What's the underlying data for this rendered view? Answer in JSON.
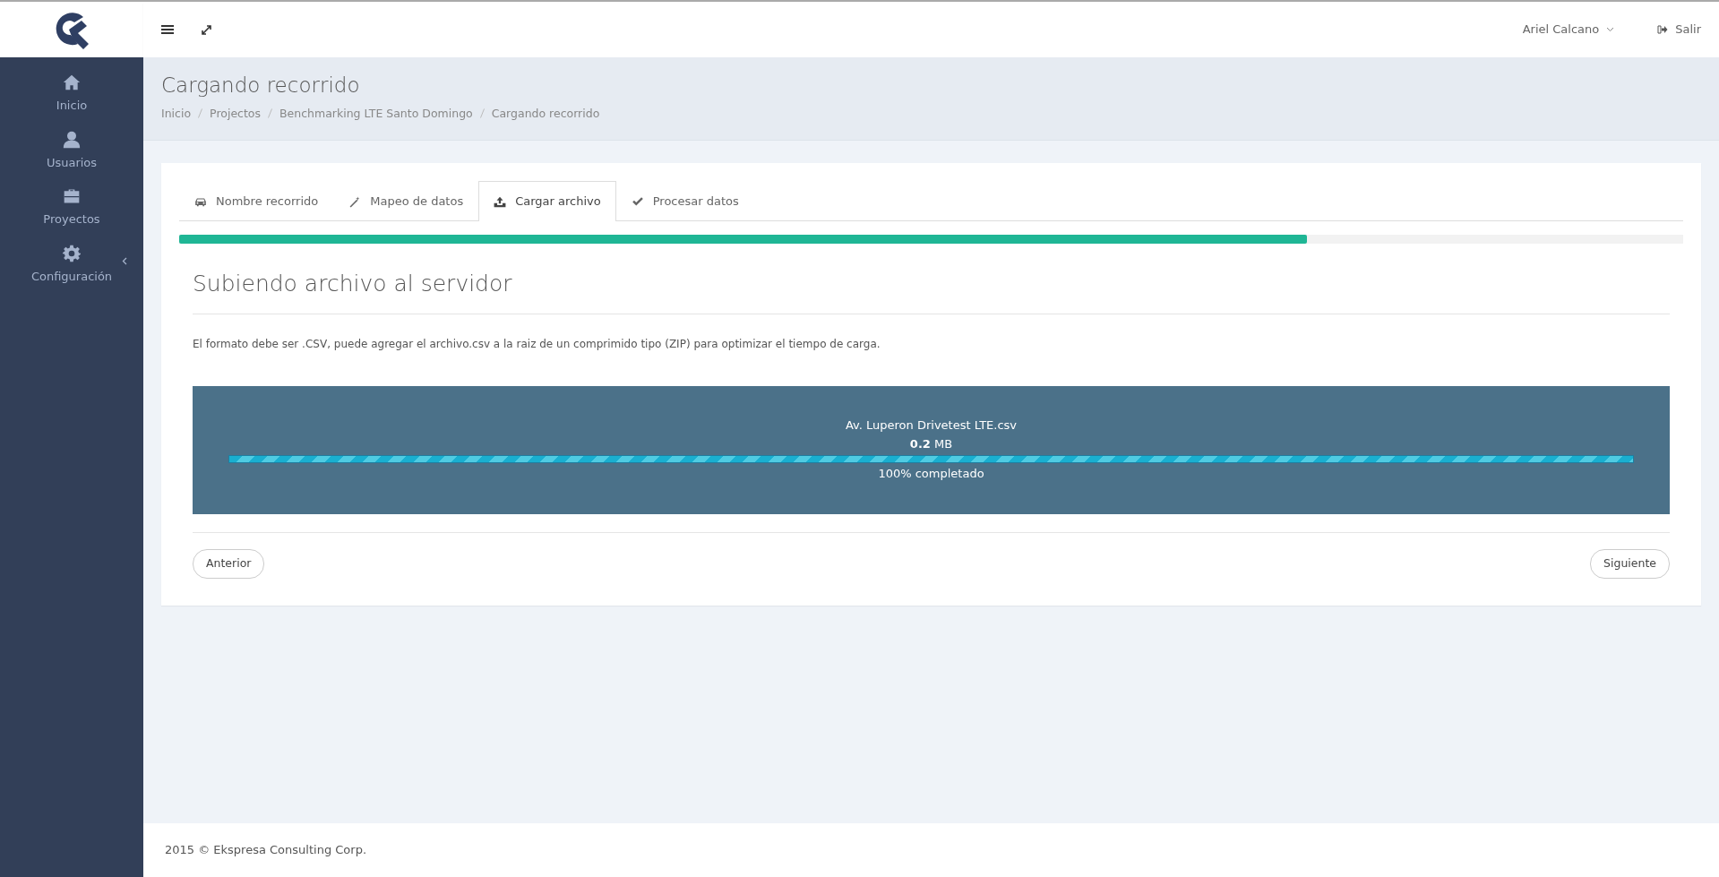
{
  "topbar": {
    "user": "Ariel Calcano",
    "logout": "Salir"
  },
  "sidebar": {
    "items": [
      {
        "label": "Inicio",
        "selected": false,
        "submenu": false
      },
      {
        "label": "Usuarios",
        "selected": false,
        "submenu": false
      },
      {
        "label": "Proyectos",
        "selected": false,
        "submenu": false
      },
      {
        "label": "Configuración",
        "selected": false,
        "submenu": true
      }
    ]
  },
  "header": {
    "title": "Cargando recorrido",
    "breadcrumb": [
      "Inicio",
      "Projectos",
      "Benchmarking LTE Santo Domingo",
      "Cargando recorrido"
    ]
  },
  "wizard": {
    "tabs": [
      {
        "label": "Nombre recorrido",
        "selected": false
      },
      {
        "label": "Mapeo de datos",
        "selected": false
      },
      {
        "label": "Cargar archivo",
        "selected": true
      },
      {
        "label": "Procesar datos",
        "selected": false
      }
    ],
    "progress": {
      "level": 0.75
    },
    "heading": "Subiendo archivo al servidor",
    "description": "El formato debe ser .CSV, puede agregar el archivo.csv a la raiz de un comprimido tipo (ZIP) para optimizar el tiempo de carga.",
    "upload": {
      "filename": "Av. Luperon Drivetest LTE.csv",
      "size": "**0.2** MB",
      "level": 1,
      "status": "100% completado"
    },
    "buttons": {
      "previous": "Anterior",
      "next": "Siguiente"
    }
  },
  "footer": {
    "text": "2015 © Ekspresa Consulting Corp."
  }
}
